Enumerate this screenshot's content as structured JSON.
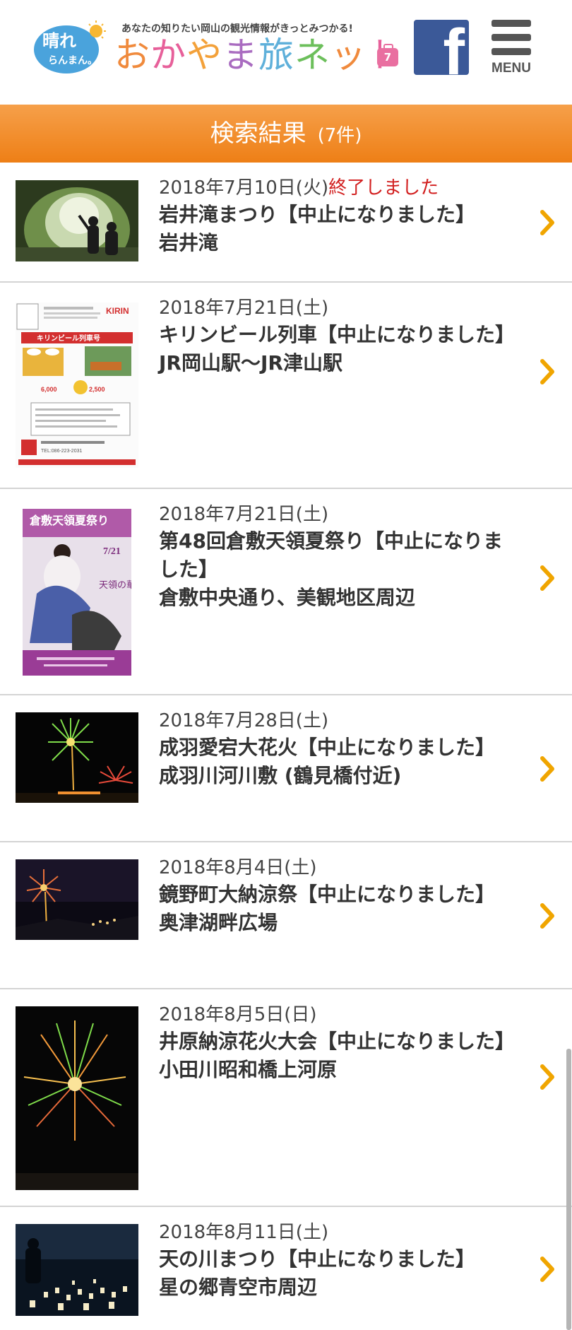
{
  "header": {
    "logo_badge_line1": "晴れ",
    "logo_badge_line2": "らんまん。",
    "logo_tagline": "あなたの知りたい岡山の観光情報がきっとみつかる!",
    "logo_title_chars": [
      "お",
      "か",
      "や",
      "ま",
      "旅",
      "ネ",
      "ッ",
      "ト"
    ],
    "logo_suitcase_mark": "7",
    "menu_label": "MENU",
    "facebook_letter": "f"
  },
  "title_bar": {
    "title": "検索結果",
    "count": "(7件)"
  },
  "results": [
    {
      "date": "2018年7月10日(火)",
      "status": "終了しました",
      "name": "岩井滝まつり【中止になりました】",
      "venue": "岩井滝"
    },
    {
      "date": "2018年7月21日(土)",
      "status": "",
      "name": "キリンビール列車【中止になりました】",
      "venue": "JR岡山駅〜JR津山駅"
    },
    {
      "date": "2018年7月21日(土)",
      "status": "",
      "name": "第48回倉敷天領夏祭り【中止になりました】",
      "venue": "倉敷中央通り、美観地区周辺"
    },
    {
      "date": "2018年7月28日(土)",
      "status": "",
      "name": "成羽愛宕大花火【中止になりました】",
      "venue": "成羽川河川敷 (鶴見橋付近)"
    },
    {
      "date": "2018年8月4日(土)",
      "status": "",
      "name": "鏡野町大納涼祭【中止になりました】",
      "venue": "奥津湖畔広場"
    },
    {
      "date": "2018年8月5日(日)",
      "status": "",
      "name": "井原納涼花火大会【中止になりました】",
      "venue": "小田川昭和橋上河原"
    },
    {
      "date": "2018年8月11日(土)",
      "status": "",
      "name": "天の川まつり【中止になりました】",
      "venue": "星の郷青空市周辺"
    }
  ],
  "flyers": {
    "kirin_brand": "KIRIN",
    "kirin_heading": "キリンビール列車号",
    "kirin_price_1": "6,000",
    "kirin_price_2": "2,500",
    "kirin_tel": "TEL:086-223-2031",
    "kurashiki_title": "倉敷天領夏祭り",
    "kurashiki_date": "7/21",
    "kurashiki_sub": "天領の華"
  },
  "colors": {
    "title_bar": "#ee7f16",
    "chevron": "#f0a500",
    "ended_text": "#d21f1f",
    "facebook": "#3b5998"
  }
}
